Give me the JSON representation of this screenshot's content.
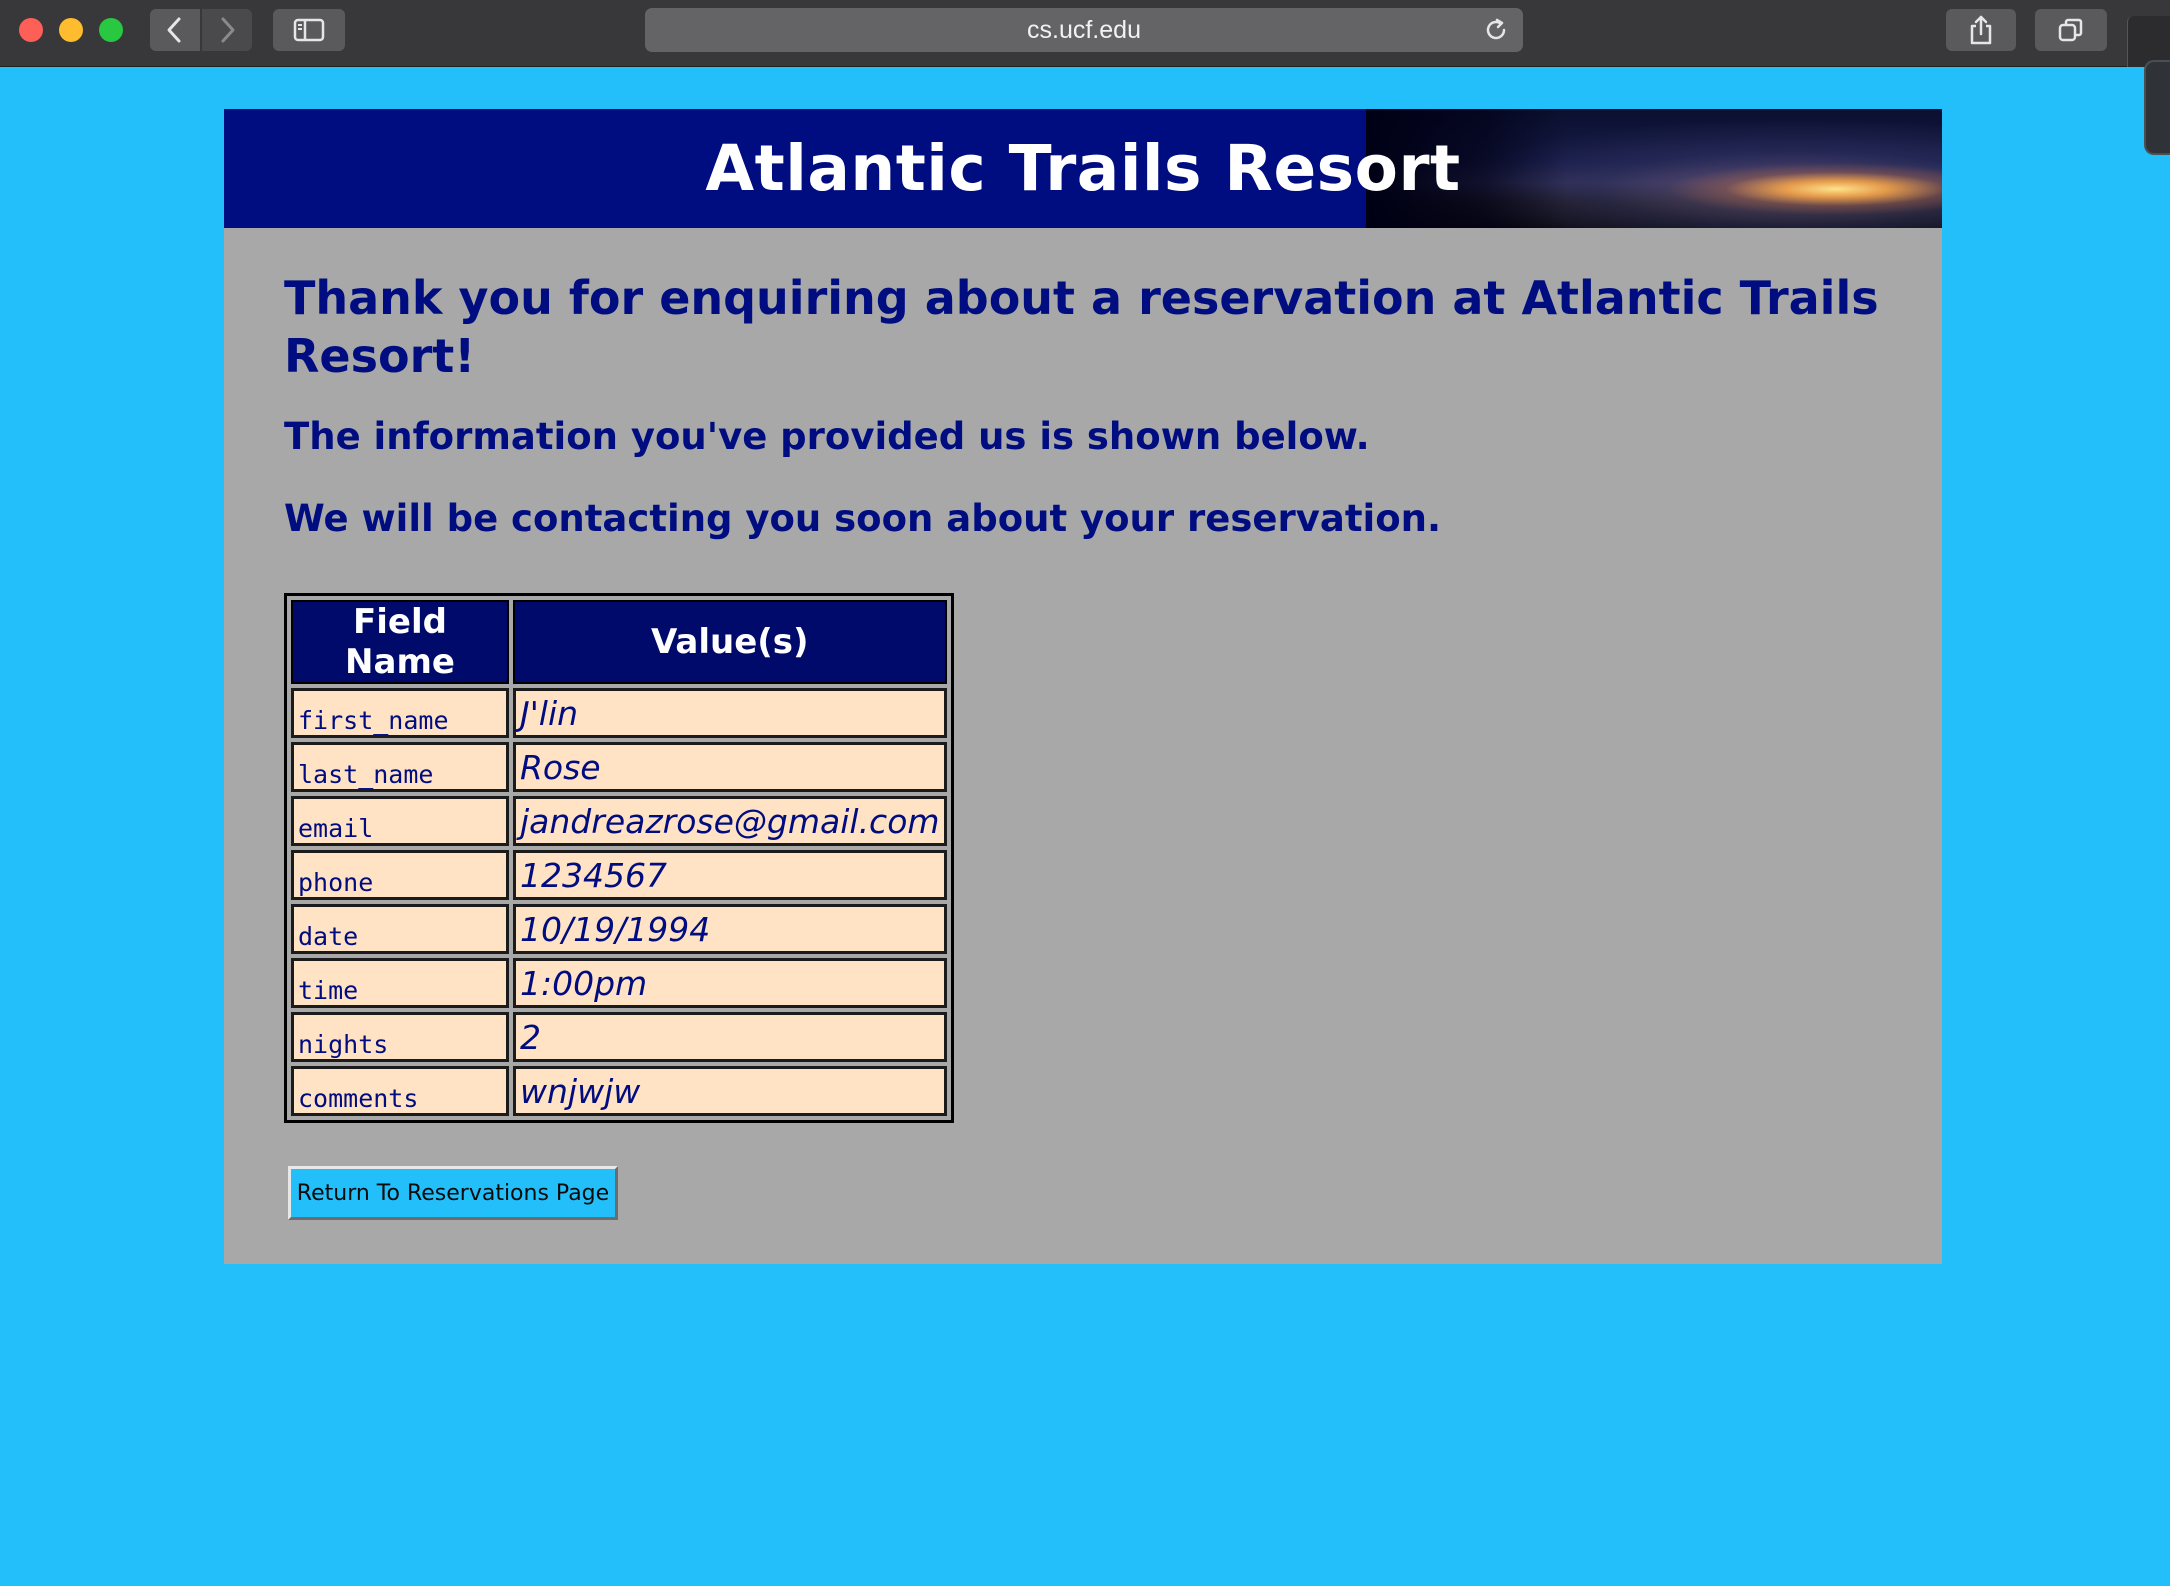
{
  "browser": {
    "url": "cs.ucf.edu"
  },
  "banner": {
    "title": "Atlantic Trails Resort"
  },
  "main": {
    "heading": "Thank you for enquiring about a reservation at Atlantic Trails Resort!",
    "info_line": "The information you've provided us is shown below.",
    "contact_line": "We will be contacting you soon about your reservation."
  },
  "table": {
    "headers": [
      "Field Name",
      "Value(s)"
    ],
    "rows": [
      {
        "field": "first_name",
        "value": "J'lin"
      },
      {
        "field": "last_name",
        "value": "Rose"
      },
      {
        "field": "email",
        "value": "jandreazrose@gmail.com"
      },
      {
        "field": "phone",
        "value": "1234567"
      },
      {
        "field": "date",
        "value": "10/19/1994"
      },
      {
        "field": "time",
        "value": "1:00pm"
      },
      {
        "field": "nights",
        "value": "2"
      },
      {
        "field": "comments",
        "value": "wnjwjw"
      }
    ]
  },
  "actions": {
    "return_label": "Return To Reservations Page"
  },
  "colors": {
    "page_background": "#22bffb",
    "content_background": "#a8a8a8",
    "navy": "#000d80",
    "cell_background": "#ffe3c4"
  }
}
